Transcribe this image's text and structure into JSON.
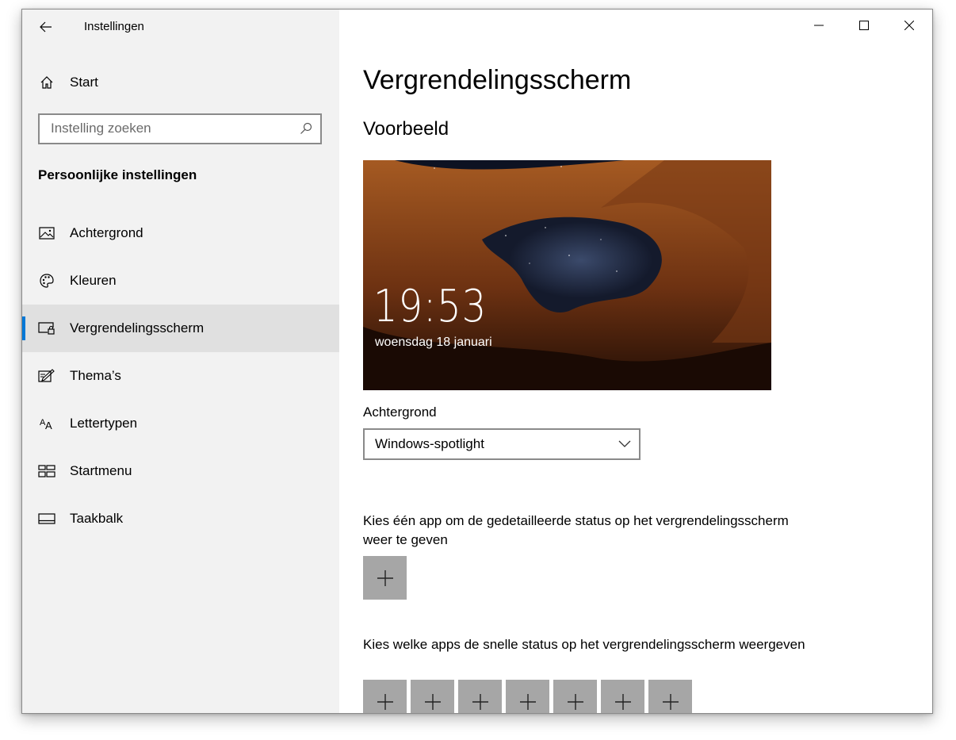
{
  "window": {
    "title": "Instellingen",
    "controls": [
      "minimize-icon",
      "maximize-icon",
      "close-icon"
    ]
  },
  "sidebar": {
    "home_label": "Start",
    "search_placeholder": "Instelling zoeken",
    "section_title": "Persoonlijke instellingen",
    "items": [
      {
        "label": "Achtergrond",
        "icon": "picture-icon"
      },
      {
        "label": "Kleuren",
        "icon": "palette-icon"
      },
      {
        "label": "Vergrendelingsscherm",
        "icon": "lock-screen-icon",
        "active": true
      },
      {
        "label": "Thema’s",
        "icon": "theme-icon"
      },
      {
        "label": "Lettertypen",
        "icon": "fonts-icon"
      },
      {
        "label": "Startmenu",
        "icon": "start-menu-icon"
      },
      {
        "label": "Taakbalk",
        "icon": "taskbar-icon"
      }
    ]
  },
  "main": {
    "title": "Vergrendelingsscherm",
    "preview_heading": "Voorbeeld",
    "preview": {
      "time": "19:53",
      "date": "woensdag 18 januari"
    },
    "background_label": "Achtergrond",
    "background_value": "Windows-spotlight",
    "detailed_status_text": "Kies één app om de gedetailleerde status op het vergrendelingsscherm weer te geven",
    "quick_status_text": "Kies welke apps de snelle status op het vergrendelingsscherm weergeven"
  },
  "colors": {
    "accent": "#0078d7",
    "sidebar_bg": "#f2f2f2",
    "tile_bg": "#a6a6a6"
  }
}
